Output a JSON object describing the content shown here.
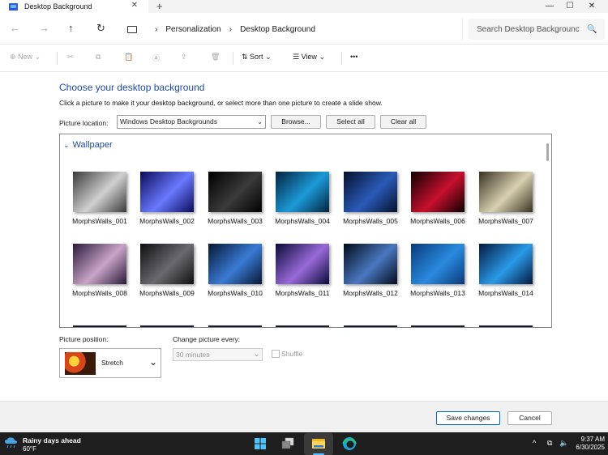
{
  "window": {
    "tab_title": "Desktop Background",
    "new_tab": "+",
    "minimize": "—",
    "maximize": "☐",
    "close": "✕"
  },
  "address": {
    "breadcrumbs": [
      "Personalization",
      "Desktop Background"
    ],
    "search_placeholder": "Search Desktop Backgrounc"
  },
  "commands": {
    "new": "New",
    "sort": "Sort",
    "view": "View",
    "more": "•••"
  },
  "main": {
    "heading": "Choose your desktop background",
    "instructions": "Click a picture to make it your desktop background, or select more than one picture to create a slide show.",
    "location_label": "Picture location:",
    "location_value": "Windows Desktop Backgrounds",
    "browse": "Browse...",
    "select_all": "Select all",
    "clear_all": "Clear all",
    "group_label": "Wallpaper",
    "wallpapers": [
      {
        "name": "MorphsWalls_001",
        "colors": [
          "#3a3a3a",
          "#d0d0d0"
        ]
      },
      {
        "name": "MorphsWalls_002",
        "colors": [
          "#0a0a5a",
          "#6a7aff"
        ]
      },
      {
        "name": "MorphsWalls_003",
        "colors": [
          "#000000",
          "#3a3a3a"
        ]
      },
      {
        "name": "MorphsWalls_004",
        "colors": [
          "#03233d",
          "#1b9ad8"
        ]
      },
      {
        "name": "MorphsWalls_005",
        "colors": [
          "#05102a",
          "#2a5bb8"
        ]
      },
      {
        "name": "MorphsWalls_006",
        "colors": [
          "#0c0000",
          "#c8102e"
        ]
      },
      {
        "name": "MorphsWalls_007",
        "colors": [
          "#3a3220",
          "#d8d0b0"
        ]
      },
      {
        "name": "MorphsWalls_008",
        "colors": [
          "#2a1a3a",
          "#c9a4c8"
        ]
      },
      {
        "name": "MorphsWalls_009",
        "colors": [
          "#0e0e12",
          "#6a6a70"
        ]
      },
      {
        "name": "MorphsWalls_010",
        "colors": [
          "#061833",
          "#3a7bd5"
        ]
      },
      {
        "name": "MorphsWalls_011",
        "colors": [
          "#0a0a3a",
          "#9a6ad8"
        ]
      },
      {
        "name": "MorphsWalls_012",
        "colors": [
          "#020a1a",
          "#4a78c0"
        ]
      },
      {
        "name": "MorphsWalls_013",
        "colors": [
          "#0a3a78",
          "#2a8ae0"
        ]
      },
      {
        "name": "MorphsWalls_014",
        "colors": [
          "#041a40",
          "#2a9ae8"
        ]
      }
    ],
    "position_label": "Picture position:",
    "position_value": "Stretch",
    "interval_label": "Change picture every:",
    "interval_value": "30 minutes",
    "shuffle_label": "Shuffle"
  },
  "footer": {
    "save": "Save changes",
    "cancel": "Cancel"
  },
  "taskbar": {
    "weather_title": "Rainy days ahead",
    "weather_temp": "60°F",
    "time": "9:37 AM",
    "date": "6/30/2025",
    "tray_chevron": "^"
  },
  "colors": {
    "accent": "#1f4aa0",
    "taskbar": "#1e1e1e"
  }
}
